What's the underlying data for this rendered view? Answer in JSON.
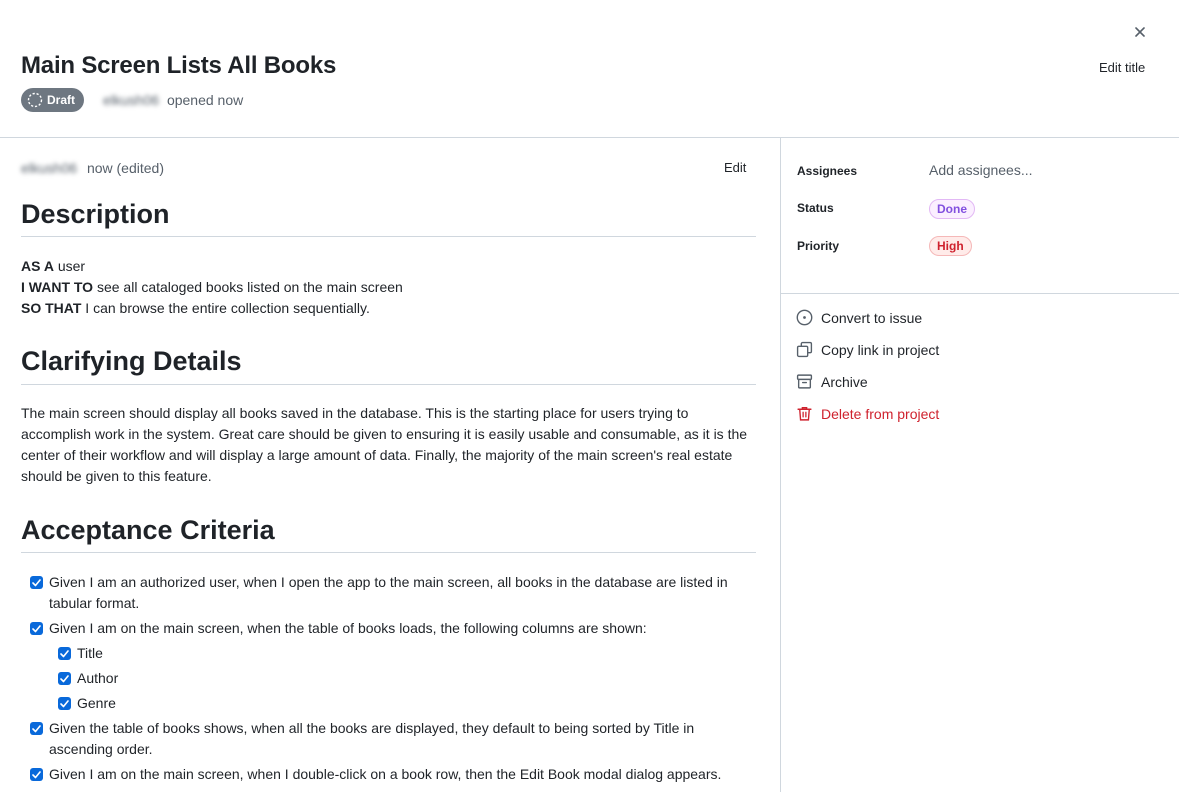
{
  "header": {
    "title": "Main Screen Lists All Books",
    "edit_title_label": "Edit title",
    "draft_badge": "Draft",
    "author_blurred": "elkush06",
    "opened_text": "opened now"
  },
  "comment": {
    "author_blurred": "elkush06",
    "time_text": "now (edited)",
    "edit_label": "Edit"
  },
  "body": {
    "description_heading": "Description",
    "story": [
      {
        "bold": "AS A",
        "text": " user"
      },
      {
        "bold": "I WANT TO",
        "text": " see all cataloged books listed on the main screen"
      },
      {
        "bold": "SO THAT",
        "text": " I can browse the entire collection sequentially."
      }
    ],
    "clarifying_heading": "Clarifying Details",
    "clarifying_text": "The main screen should display all books saved in the database. This is the starting place for users trying to accomplish work in the system. Great care should be given to ensuring it is easily usable and consumable, as it is the center of their workflow and will display a large amount of data. Finally, the majority of the main screen's real estate should be given to this feature.",
    "acceptance_heading": "Acceptance Criteria",
    "criteria": [
      {
        "text": "Given I am an authorized user, when I open the app to the main screen, all books in the database are listed in tabular format.",
        "checked": true
      },
      {
        "text": "Given I am on the main screen, when the table of books loads, the following columns are shown:",
        "checked": true,
        "sub": [
          "Title",
          "Author",
          "Genre"
        ]
      },
      {
        "text": "Given the table of books shows, when all the books are displayed, they default to being sorted by Title in ascending order.",
        "checked": true
      },
      {
        "text": "Given I am on the main screen, when I double-click on a book row, then the Edit Book modal dialog appears.",
        "checked": true
      }
    ]
  },
  "sidebar": {
    "assignees_label": "Assignees",
    "assignees_value": "Add assignees...",
    "status_label": "Status",
    "status_value": "Done",
    "priority_label": "Priority",
    "priority_value": "High",
    "actions": {
      "convert": "Convert to issue",
      "copy_link": "Copy link in project",
      "archive": "Archive",
      "delete": "Delete from project"
    }
  },
  "colors": {
    "done_text": "#8250df",
    "high_text": "#cf222e",
    "danger": "#cf222e",
    "checkbox": "#0969da",
    "draft_badge": "#6e7781"
  }
}
